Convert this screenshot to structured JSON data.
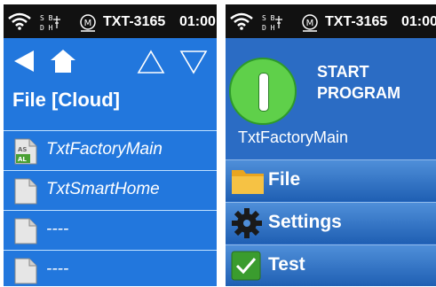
{
  "colors": {
    "left_bg": "#2277dd",
    "right_bg": "#2b6cc4",
    "statusbar": "#111111",
    "start_green": "#5fd04a"
  },
  "statusbar": {
    "device_id": "TXT-3165",
    "time": "01:00",
    "usb_lines": [
      "S B",
      "D H"
    ],
    "motor_badge": "M"
  },
  "file_screen": {
    "title": "File [Cloud]",
    "files": [
      {
        "name": "TxtFactoryMain",
        "icon": "asal-file-icon",
        "icon_text": [
          "AS",
          "AL"
        ]
      },
      {
        "name": "TxtSmartHome",
        "icon": "file-icon"
      },
      {
        "name": "----",
        "icon": "file-icon"
      },
      {
        "name": "----",
        "icon": "file-icon"
      }
    ]
  },
  "main_screen": {
    "start_label_line1": "START",
    "start_label_line2": "PROGRAM",
    "program_name": "TxtFactoryMain",
    "menu": [
      {
        "label": "File",
        "icon": "folder-icon"
      },
      {
        "label": "Settings",
        "icon": "gear-icon"
      },
      {
        "label": "Test",
        "icon": "checkmark-icon"
      }
    ]
  }
}
